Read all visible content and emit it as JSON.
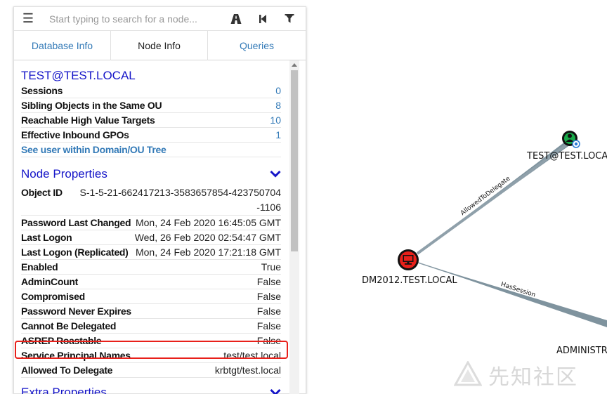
{
  "search": {
    "placeholder": "Start typing to search for a node..."
  },
  "tabs": [
    {
      "label": "Database Info",
      "active": false
    },
    {
      "label": "Node Info",
      "active": true
    },
    {
      "label": "Queries",
      "active": false
    }
  ],
  "node": {
    "name": "TEST@TEST.LOCAL",
    "overview": [
      {
        "key": "Sessions",
        "value": "0"
      },
      {
        "key": "Sibling Objects in the Same OU",
        "value": "8"
      },
      {
        "key": "Reachable High Value Targets",
        "value": "10"
      },
      {
        "key": "Effective Inbound GPOs",
        "value": "1"
      }
    ],
    "tree_link": "See user within Domain/OU Tree"
  },
  "node_properties": {
    "title": "Node Properties",
    "object_id": {
      "key": "Object ID",
      "value": "S-1-5-21-662417213-3583657854-423750704-1106"
    },
    "rows": [
      {
        "key": "Password Last Changed",
        "value": "Mon, 24 Feb 2020 16:45:05 GMT"
      },
      {
        "key": "Last Logon",
        "value": "Wed, 26 Feb 2020 02:54:47 GMT"
      },
      {
        "key": "Last Logon (Replicated)",
        "value": "Mon, 24 Feb 2020 17:21:18 GMT"
      },
      {
        "key": "Enabled",
        "value": "True"
      },
      {
        "key": "AdminCount",
        "value": "False"
      },
      {
        "key": "Compromised",
        "value": "False"
      },
      {
        "key": "Password Never Expires",
        "value": "False"
      },
      {
        "key": "Cannot Be Delegated",
        "value": "False"
      },
      {
        "key": "ASREP Roastable",
        "value": "False"
      },
      {
        "key": "Service Principal Names",
        "value": "test/test.local"
      },
      {
        "key": "Allowed To Delegate",
        "value": "krbtgt/test.local"
      }
    ]
  },
  "extra_properties": {
    "title": "Extra Properties"
  },
  "graph": {
    "nodes": [
      {
        "label": "TEST@TEST.LOCA",
        "kind": "user-icon"
      },
      {
        "label": "DM2012.TEST.LOCAL",
        "kind": "computer-icon"
      },
      {
        "label": "ADMINISTR",
        "kind": "user-icon"
      }
    ],
    "edges": [
      {
        "label": "AllowedToDelegate"
      },
      {
        "label": "HasSession"
      }
    ]
  },
  "watermark": "先知社区",
  "colors": {
    "link": "#337ab7",
    "section_title": "#1515c8",
    "highlight": "#e8201a",
    "edge": "#7f939e",
    "user_node": "#17a948",
    "computer_node": "#e8201a"
  }
}
